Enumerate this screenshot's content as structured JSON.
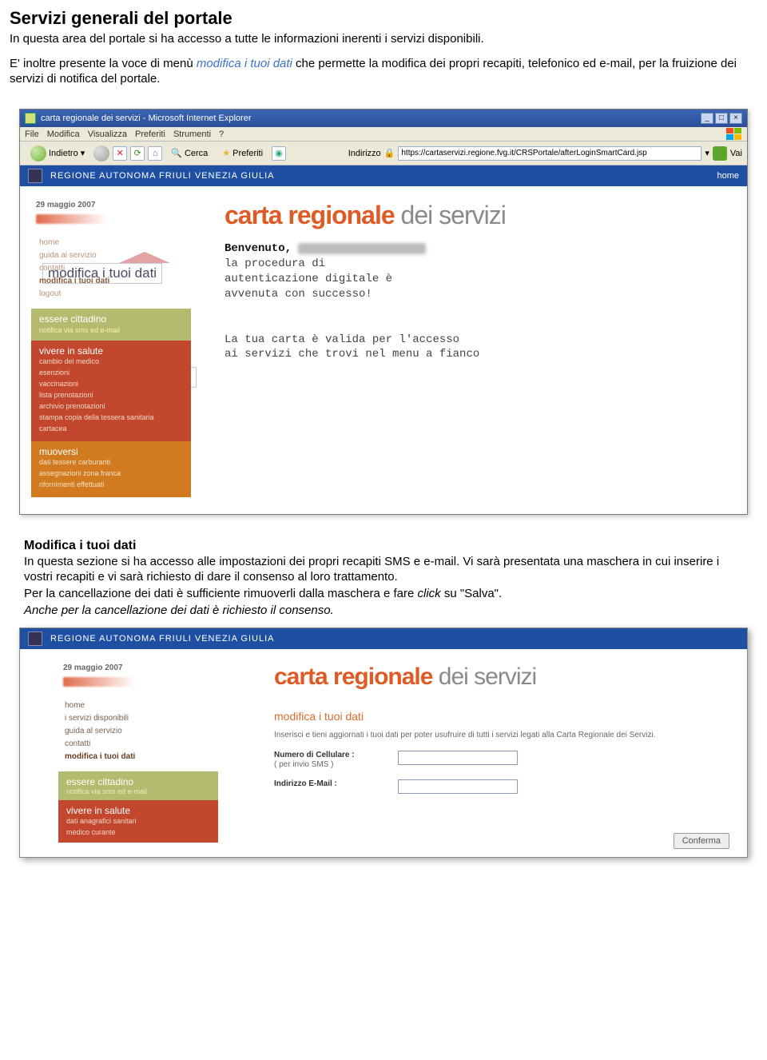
{
  "doc": {
    "title": "Servizi generali del portale",
    "p1": "In questa area del portale si ha accesso a tutte le informazioni inerenti i servizi disponibili.",
    "p2a": "E' inoltre presente la voce di menù ",
    "p2_link": "modifica i tuoi dati",
    "p2b": " che permette la modifica dei propri recapiti, telefonico ed e-mail, per la fruizione dei servizi di notifica del portale.",
    "sub_title": "Modifica i tuoi dati",
    "p3": "In questa sezione si ha accesso alle impostazioni dei propri recapiti SMS e e-mail. Vi sarà presentata una maschera in cui inserire i vostri recapiti e vi sarà richiesto di dare il consenso al loro trattamento.",
    "p4a": "Per la cancellazione dei dati è sufficiente rimuoverli dalla maschera e fare ",
    "p4_em": "click",
    "p4b": " su \"Salva\".",
    "p5": "Anche per la cancellazione dei dati è richiesto il consenso."
  },
  "callouts": {
    "modifica": "modifica i tuoi dati",
    "notifica": "notifica via sms ed e-mail"
  },
  "win": {
    "title": "carta regionale dei servizi - Microsoft Internet Explorer",
    "menus": [
      "File",
      "Modifica",
      "Visualizza",
      "Preferiti",
      "Strumenti",
      "?"
    ],
    "back_label": "Indietro",
    "search_label": "Cerca",
    "fav_label": "Preferiti",
    "addr_label": "Indirizzo",
    "addr_value": "https://cartaservizi.regione.fvg.it/CRSPortale/afterLoginSmartCard.jsp",
    "go_label": "Vai"
  },
  "page": {
    "region_bar": "REGIONE AUTONOMA FRIULI VENEZIA GIULIA",
    "home": "home",
    "brand_bold": "carta regionale",
    "brand_light": " dei servizi",
    "date": "29 maggio 2007",
    "welcome_label": "Benvenuto,",
    "welcome_lines": [
      "la procedura di",
      "autenticazione digitale è",
      "avvenuta con successo!"
    ],
    "welcome_para2": [
      "La tua carta è valida per l'accesso",
      "ai servizi che trovi nel menu a fianco"
    ],
    "menu_top_items": [
      "home",
      "guida ai servizio",
      "contatti",
      "modifica i tuoi dati",
      "logout"
    ],
    "sec_olive": {
      "title": "essere cittadino",
      "sub": "notifica via sms ed e-mail"
    },
    "sec_red": {
      "title": "vivere in salute",
      "items": [
        "cambio del medico",
        "esenzioni",
        "vaccinazioni",
        "lista prenotazioni",
        "archivio prenotazioni",
        "stampa copia della tessera sanitaria",
        "cartacea"
      ]
    },
    "sec_orange": {
      "title": "muoversi",
      "items": [
        "dati tessere carburanti",
        "assegnazioni zona franca",
        "rifornimenti effettuati"
      ]
    }
  },
  "page2": {
    "menu_top_items": [
      "home",
      "i servizi disponibili",
      "guida al servizio",
      "contatti",
      "modifica i tuoi dati"
    ],
    "sec_olive": {
      "title": "essere cittadino",
      "sub": "notifica via sms ed e-mail"
    },
    "sec_red": {
      "title": "vivere in salute",
      "items": [
        "dati anagrafici sanitari",
        "medico curante"
      ]
    },
    "form_title": "modifica i tuoi dati",
    "form_desc": "Inserisci e tieni aggiornati i tuoi dati per poter usufruire di tutti i servizi legati alla Carta Regionale dei Servizi.",
    "field_cell": "Numero di Cellulare :",
    "field_cell_note": "( per invio SMS )",
    "field_email": "Indirizzo E-Mail :",
    "confirm": "Conferma"
  }
}
